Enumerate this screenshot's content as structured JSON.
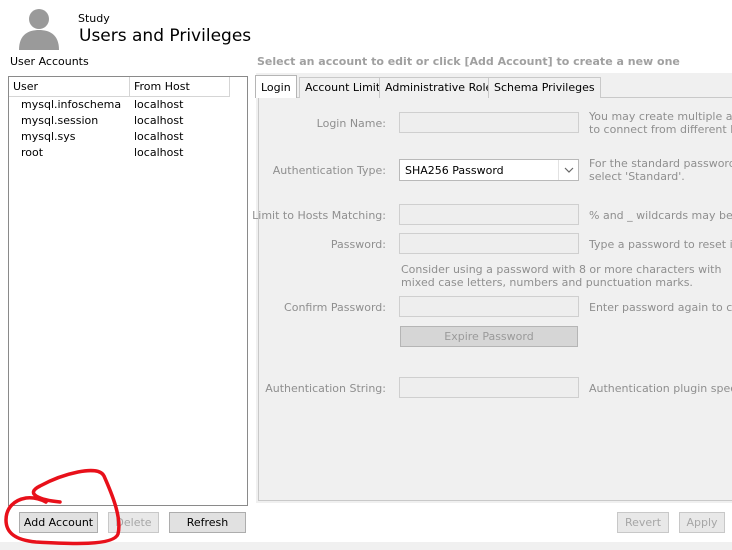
{
  "header": {
    "breadcrumb": "Study",
    "title": "Users and Privileges"
  },
  "accounts": {
    "label": "User Accounts",
    "columns": [
      "User",
      "From Host"
    ],
    "rows": [
      {
        "user": "mysql.infoschema",
        "host": "localhost"
      },
      {
        "user": "mysql.session",
        "host": "localhost"
      },
      {
        "user": "mysql.sys",
        "host": "localhost"
      },
      {
        "user": "root",
        "host": "localhost"
      }
    ],
    "buttons": {
      "add": "Add Account",
      "delete": "Delete",
      "refresh": "Refresh"
    }
  },
  "details": {
    "hint": "Select an account to edit or click [Add Account] to create a new one",
    "tabs": [
      "Login",
      "Account Limits",
      "Administrative Roles",
      "Schema Privileges"
    ],
    "active_tab": "Login",
    "form": {
      "login_name": {
        "label": "Login Name:",
        "value": "",
        "description": [
          "You may create multiple accou",
          "to connect from different host"
        ]
      },
      "auth_type": {
        "label": "Authentication Type:",
        "value": "SHA256 Password",
        "description": [
          "For the standard password an",
          "select 'Standard'."
        ]
      },
      "limit_hosts": {
        "label": "Limit to Hosts Matching:",
        "value": "",
        "description": [
          "% and _ wildcards may be use"
        ]
      },
      "password": {
        "label": "Password:",
        "value": "",
        "description": [
          "Type a password to reset it."
        ]
      },
      "password_note": [
        "Consider using a password with 8 or more characters with",
        "mixed case letters, numbers and punctuation marks."
      ],
      "confirm_password": {
        "label": "Confirm Password:",
        "value": "",
        "description": [
          "Enter password again to confi"
        ]
      },
      "expire_button": "Expire Password",
      "auth_string": {
        "label": "Authentication String:",
        "value": "",
        "description": [
          "Authentication plugin specific p"
        ]
      }
    },
    "buttons": {
      "revert": "Revert",
      "apply": "Apply"
    }
  },
  "colors": {
    "annotation": "#e8101a",
    "panel_background": "#f0f0f0",
    "disabled_text": "#8f8f8f"
  },
  "icons": {
    "avatar": "user-avatar-icon",
    "dropdown": "chevron-down-icon"
  }
}
